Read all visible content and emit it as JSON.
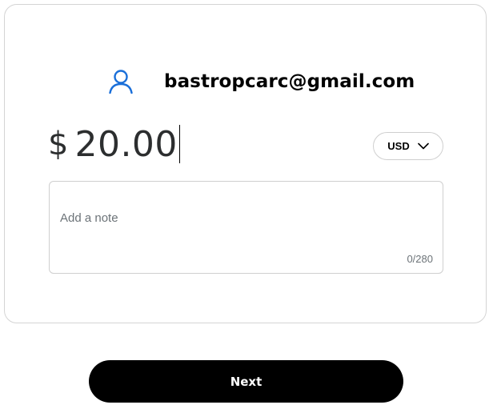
{
  "recipient": {
    "icon": "user-icon",
    "email": "bastropcarc@gmail.com",
    "icon_color": "#1a6fd9"
  },
  "amount": {
    "symbol": "$",
    "value": "20.00"
  },
  "currency": {
    "selected": "USD",
    "icon": "chevron-down-icon"
  },
  "note": {
    "placeholder": "Add a note",
    "counter": "0/280"
  },
  "actions": {
    "next_label": "Next"
  },
  "colors": {
    "primary_button": "#000000",
    "button_text": "#ffffff",
    "border": "#cfcfcf",
    "muted_text": "#6c7378"
  }
}
